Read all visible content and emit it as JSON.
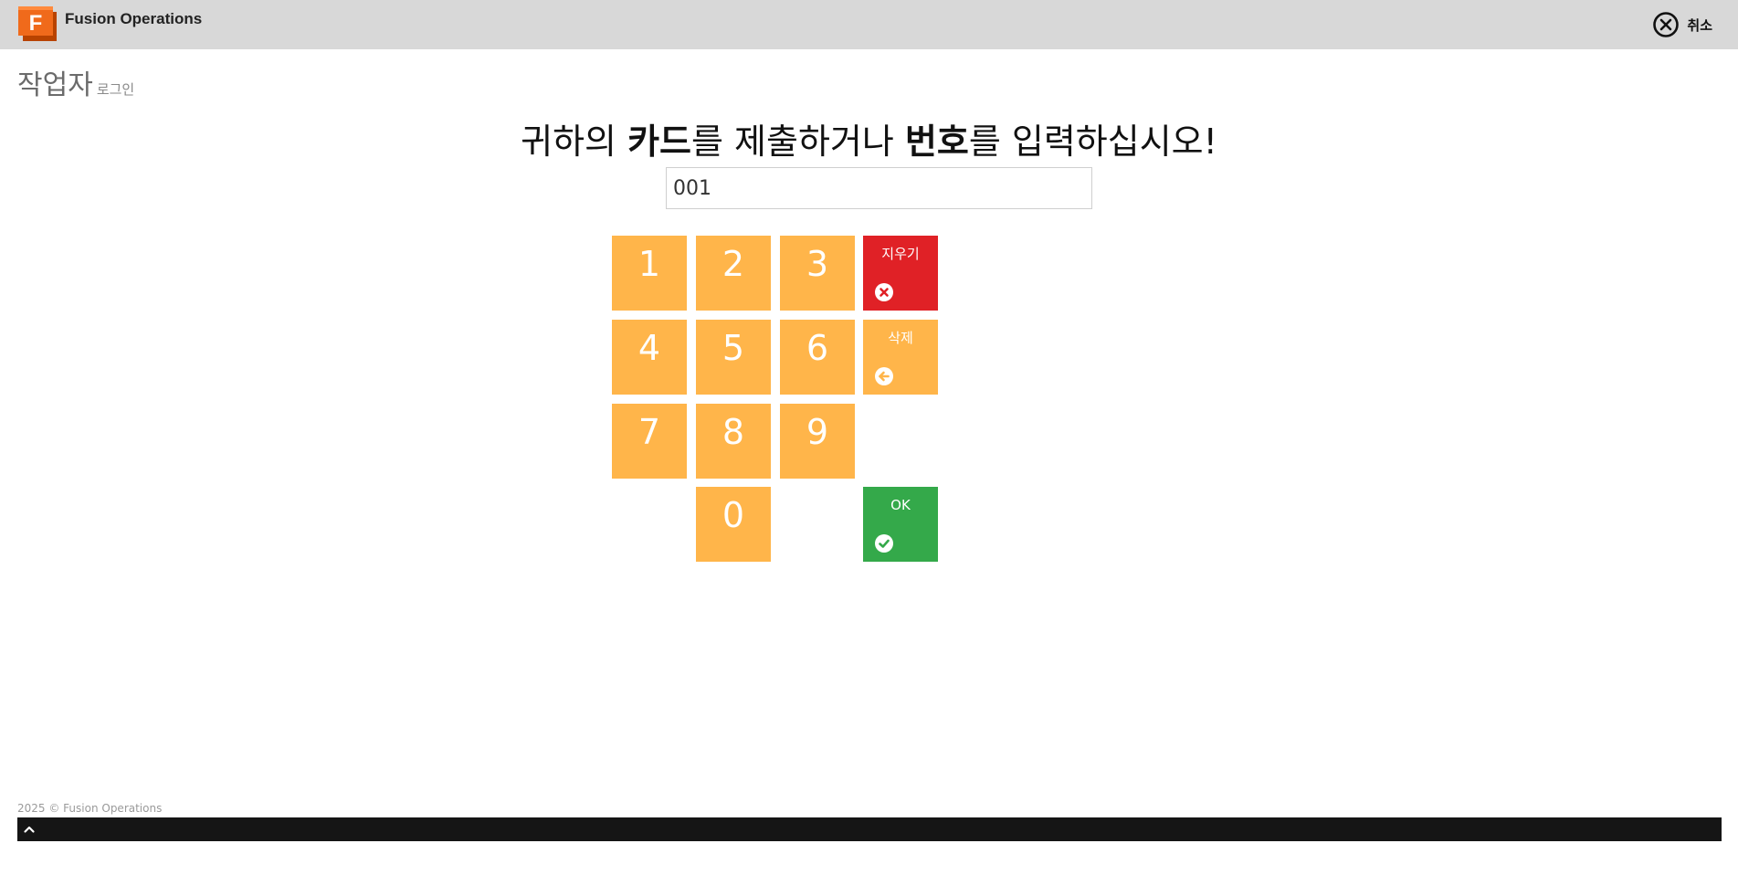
{
  "app": {
    "logo_letter": "F",
    "title": "Fusion Operations",
    "brand_color": "#f06a1b"
  },
  "header": {
    "cancel_label": "취소",
    "cancel_icon": "close-circle-icon"
  },
  "page": {
    "title": "작업자",
    "subtitle": "로그인"
  },
  "prompt": {
    "part1": "귀하의 ",
    "bold1": "카드",
    "part2": "를 제출하거나 ",
    "bold2": "번호",
    "part3": "를 입력하십시오!"
  },
  "input": {
    "value": "001"
  },
  "keypad": {
    "digits": [
      "1",
      "2",
      "3",
      "4",
      "5",
      "6",
      "7",
      "8",
      "9",
      "0"
    ],
    "clear_label": "지우기",
    "clear_icon": "times-circle-icon",
    "delete_label": "삭제",
    "delete_icon": "arrow-left-circle-icon",
    "ok_label": "OK",
    "ok_icon": "check-circle-icon",
    "colors": {
      "digit": "#ffb54a",
      "clear": "#e02126",
      "ok": "#34a94a"
    }
  },
  "footer": {
    "copyright": "2025 © Fusion Operations",
    "toggle_icon": "chevron-up-icon"
  }
}
